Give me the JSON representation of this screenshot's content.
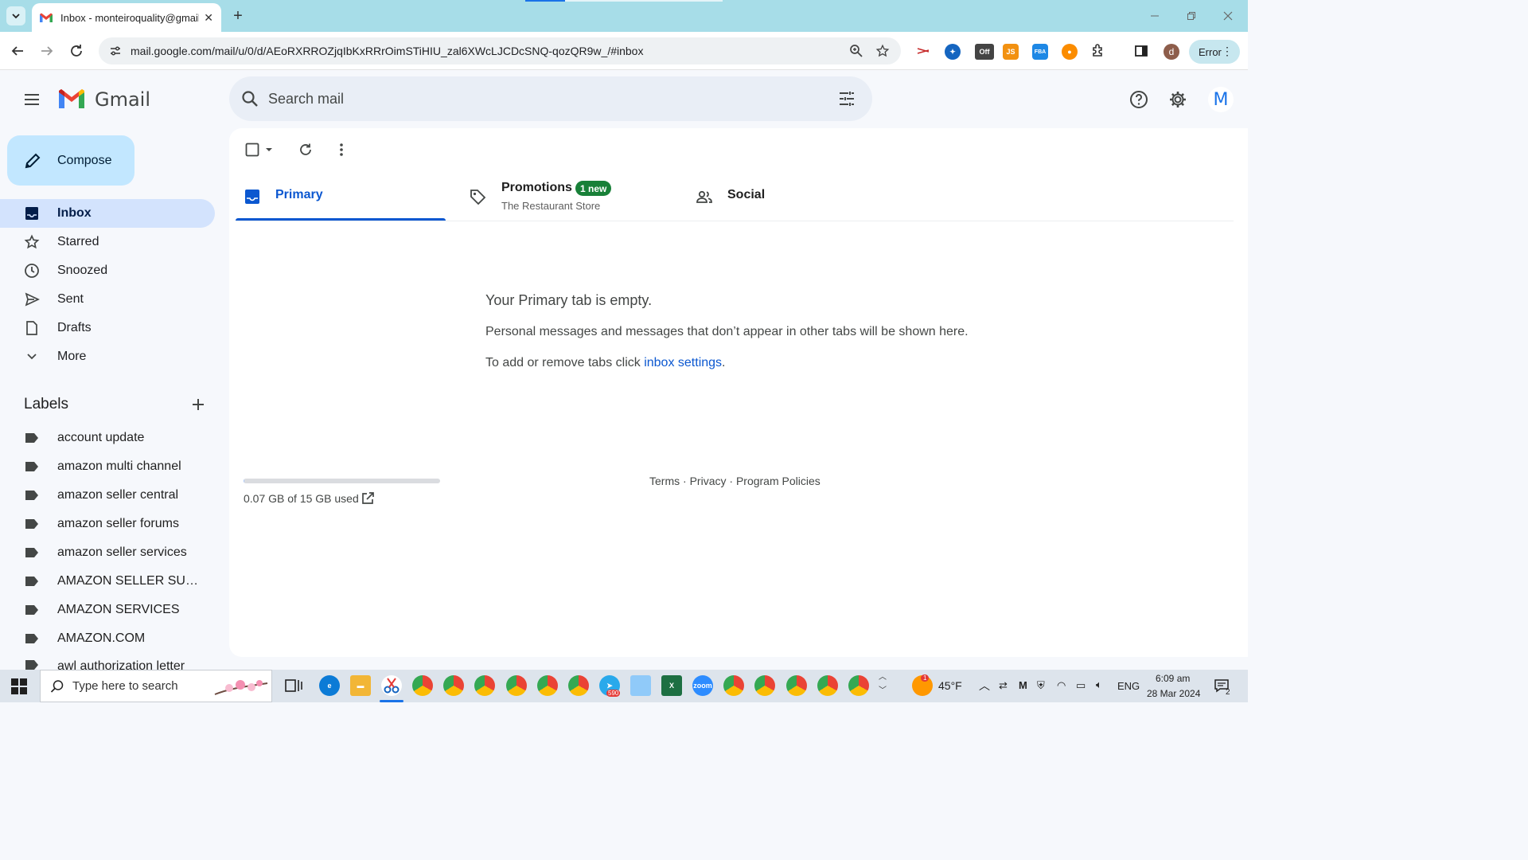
{
  "browser": {
    "tab_title": "Inbox - monteiroquality@gmail",
    "url": "mail.google.com/mail/u/0/d/AEoRXRROZjqIbKxRRrOimSTiHIU_zal6XWcLJCDcSNQ-qozQR9w_/#inbox",
    "error_chip": "Error",
    "profile_initial": "d",
    "ext_off_label": "Off",
    "ext_js_label": "JS",
    "ext_fba_label": "FBA"
  },
  "gmail": {
    "product_name": "Gmail",
    "search_placeholder": "Search mail",
    "avatar_initial": "M"
  },
  "sidebar": {
    "compose_label": "Compose",
    "nav": [
      {
        "label": "Inbox",
        "icon": "inbox-icon"
      },
      {
        "label": "Starred",
        "icon": "star-icon"
      },
      {
        "label": "Snoozed",
        "icon": "clock-icon"
      },
      {
        "label": "Sent",
        "icon": "send-icon"
      },
      {
        "label": "Drafts",
        "icon": "draft-icon"
      },
      {
        "label": "More",
        "icon": "chevron-down-icon"
      }
    ],
    "labels_heading": "Labels",
    "labels": [
      "account update",
      "amazon multi channel",
      "amazon seller central",
      "amazon seller forums",
      "amazon seller services",
      "AMAZON SELLER SUPP...",
      "AMAZON SERVICES",
      "AMAZON.COM",
      "awl authorization letter"
    ]
  },
  "main": {
    "tabs": {
      "primary": "Primary",
      "promotions": "Promotions",
      "promotions_badge": "1 new",
      "promotions_sub": "The Restaurant Store",
      "social": "Social"
    },
    "empty_title": "Your Primary tab is empty.",
    "empty_body": "Personal messages and messages that don’t appear in other tabs will be shown here.",
    "empty_settings_prefix": "To add or remove tabs click ",
    "empty_settings_link": "inbox settings",
    "empty_settings_suffix": ".",
    "storage_text": "0.07 GB of 15 GB used",
    "storage_used_fraction": 0.005,
    "footer": {
      "terms": "Terms",
      "privacy": "Privacy",
      "policies": "Program Policies",
      "separator": " · "
    }
  },
  "taskbar": {
    "search_placeholder": "Type here to search",
    "weather": "45°F",
    "language": "ENG",
    "time": "6:09 am",
    "date": "28 Mar 2024",
    "notification_count": "2",
    "telegram_badge": "590",
    "weather_badge": "1"
  },
  "colors": {
    "accent": "#0b57d0",
    "compose_bg": "#c2e7ff",
    "active_nav_bg": "#d3e3fd",
    "badge_green": "#188038",
    "tabstrip": "#a7dde8"
  }
}
